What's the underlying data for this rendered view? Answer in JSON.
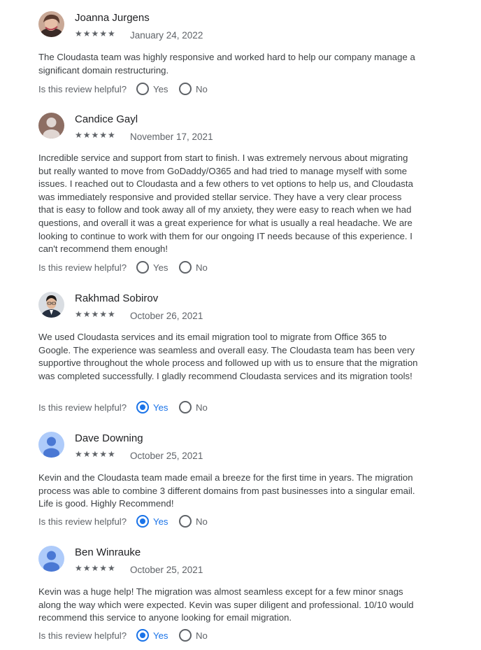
{
  "helpful_prompt": "Is this review helpful?",
  "yes_label": "Yes",
  "no_label": "No",
  "reviews": [
    {
      "name": "Joanna Jurgens",
      "stars": "★★★★★",
      "date": "January 24, 2022",
      "text": "The Cloudasta team was highly responsive and worked hard to help our company manage a significant domain restructuring.",
      "helpful": "none",
      "avatar": "photo-woman"
    },
    {
      "name": "Candice Gayl",
      "stars": "★★★★★",
      "date": "November 17, 2021",
      "text": "Incredible service and support from start to finish.  I was extremely nervous about migrating but really wanted to move from GoDaddy/O365 and had tried to manage myself with some issues.  I reached out to Cloudasta and a few others to vet options to help us, and Cloudasta was immediately responsive and provided stellar service. They have a very clear process that is easy to follow and took away all of my anxiety, they were easy to reach when we had questions, and overall it was a great experience for what is usually a real headache. We are looking to continue to work with them for our ongoing IT needs because of this experience. I can't recommend them enough!",
      "helpful": "none",
      "avatar": "default-brown"
    },
    {
      "name": "Rakhmad Sobirov",
      "stars": "★★★★★",
      "date": "October 26, 2021",
      "text": "We used Cloudasta services and its email migration tool to migrate from Office 365 to Google. The experience was seamless and overall easy. The Cloudasta team has been very supportive throughout the whole process and followed up with us to ensure that the migration was completed successfully. I gladly recommend Cloudasta services and its migration tools!",
      "helpful": "yes",
      "avatar": "photo-man"
    },
    {
      "name": "Dave Downing",
      "stars": "★★★★★",
      "date": "October 25, 2021",
      "text": "Kevin and the Cloudasta team made email a breeze for the first time in years. The migration process was able to combine 3 different domains from past businesses into a singular email. Life is good. Highly Recommend!",
      "helpful": "yes",
      "avatar": "default-blue"
    },
    {
      "name": "Ben Winrauke",
      "stars": "★★★★★",
      "date": "October 25, 2021",
      "text": "Kevin was a huge help! The migration was almost seamless except for a few minor snags along the way which were expected. Kevin was super diligent and professional. 10/10 would recommend this service to anyone looking for email migration.",
      "helpful": "yes",
      "avatar": "default-blue"
    }
  ]
}
